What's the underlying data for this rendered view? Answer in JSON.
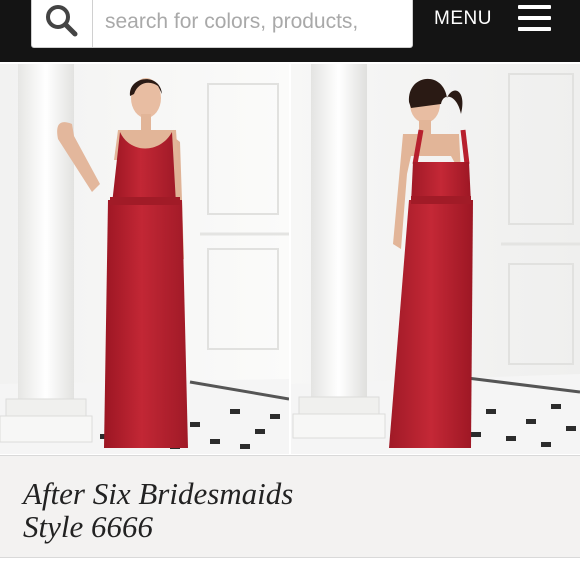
{
  "header": {
    "search": {
      "placeholder": "search for colors, products,"
    },
    "menu_label": "MENU",
    "icons": [
      "search-icon",
      "hamburger-menu-icon"
    ]
  },
  "product": {
    "photos": [
      "front-view",
      "back-view"
    ],
    "dress_color": "#b7202e",
    "title_line1": "After Six Bridesmaids",
    "title_line2": "Style 6666"
  },
  "colors": {
    "header_bg": "#141414",
    "title_band_bg": "#f3f2f1"
  }
}
